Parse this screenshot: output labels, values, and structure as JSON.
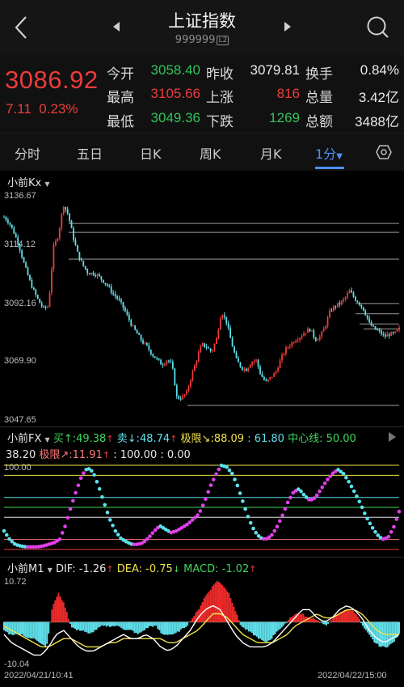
{
  "header": {
    "title": "上证指数",
    "code": "999999",
    "code_badge": "L2"
  },
  "quote": {
    "price": "3086.92",
    "change": "7.11",
    "change_pct": "0.23%",
    "rows": [
      [
        {
          "label": "今开",
          "value": "3058.40",
          "color": "green"
        },
        {
          "label": "昨收",
          "value": "3079.81",
          "color": "white"
        },
        {
          "label": "换手",
          "value": "0.84%",
          "color": "white"
        }
      ],
      [
        {
          "label": "最高",
          "value": "3105.66",
          "color": "red"
        },
        {
          "label": "上涨",
          "value": "816",
          "color": "red"
        },
        {
          "label": "总量",
          "value": "3.42亿",
          "color": "white"
        }
      ],
      [
        {
          "label": "最低",
          "value": "3049.36",
          "color": "green"
        },
        {
          "label": "下跌",
          "value": "1269",
          "color": "green"
        },
        {
          "label": "总额",
          "value": "3488亿",
          "color": "white"
        }
      ]
    ]
  },
  "tabs": [
    "分时",
    "五日",
    "日K",
    "周K",
    "月K",
    "1分"
  ],
  "kline": {
    "name": "小前Kx",
    "y_ticks": [
      "3136.67",
      "3114.12",
      "3092.16",
      "3069.90",
      "3047.65"
    ],
    "ylim": [
      3047.65,
      3136.67
    ],
    "up_color": "#ee3b3b",
    "down_color": "#5fe0ea"
  },
  "fx": {
    "name": "小前FX",
    "buy": "买↑:49.38",
    "sell": "卖↓:48.74",
    "limit": "极限↘:88.09",
    "v61": ": 61.80",
    "center": "中心线: 50.00",
    "line2a": "38.20",
    "limit2": "极限↗:11.91",
    "line2b": ": 100.00 : 0.00",
    "y_top": "100.00"
  },
  "macd": {
    "name": "小前M1",
    "dif": "DIF: -1.26",
    "dea": "DEA: -0.75",
    "macd": "MACD: -1.02",
    "y_top": "10.72",
    "y_bottom": "-10.04",
    "time_start": "2022/04/21/10:41",
    "time_end": "2022/04/22/15:00"
  },
  "chart_data": {
    "type": "candlestick",
    "ylim": [
      3047.65,
      3136.67
    ],
    "close_path": [
      3128,
      3126,
      3122,
      3117,
      3110,
      3104,
      3099,
      3095,
      3092,
      3093,
      3116,
      3121,
      3133,
      3129,
      3120,
      3113,
      3109,
      3106,
      3106,
      3105,
      3103,
      3101,
      3098,
      3096,
      3093,
      3089,
      3085,
      3082,
      3079,
      3077,
      3074,
      3072,
      3070,
      3072,
      3070,
      3057,
      3057,
      3059,
      3066,
      3072,
      3078,
      3077,
      3075,
      3080,
      3091,
      3087,
      3079,
      3072,
      3069,
      3068,
      3071,
      3072,
      3066,
      3063,
      3065,
      3067,
      3072,
      3076,
      3078,
      3080,
      3081,
      3083,
      3084,
      3080,
      3081,
      3085,
      3091,
      3093,
      3094,
      3096,
      3099,
      3096,
      3094,
      3091,
      3086,
      3084,
      3083,
      3081,
      3082,
      3082,
      3084
    ]
  }
}
